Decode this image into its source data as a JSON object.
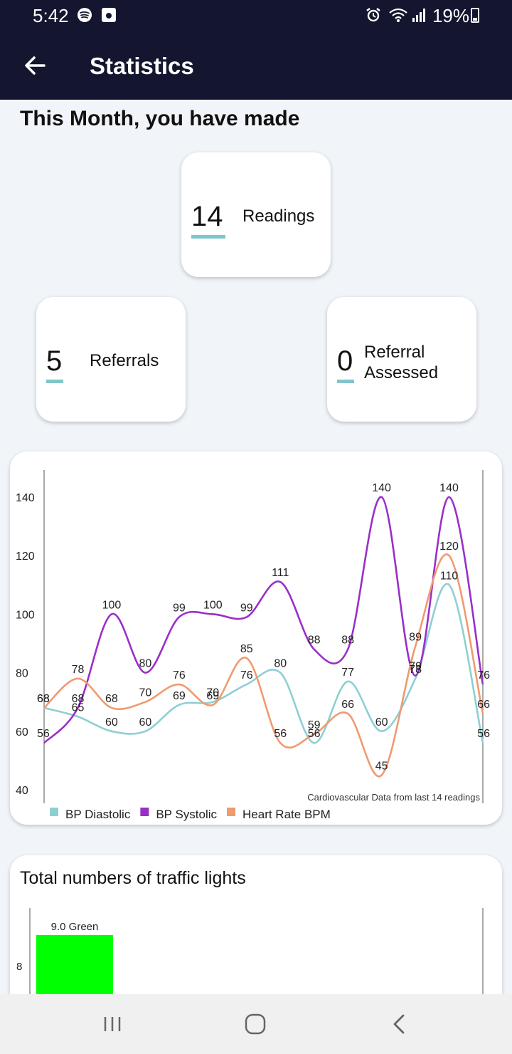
{
  "status_bar": {
    "time": "5:42",
    "battery": "19%"
  },
  "app_bar": {
    "title": "Statistics"
  },
  "summary": {
    "heading": "This Month, you have made",
    "readings": {
      "value": "14",
      "label": "Readings"
    },
    "referrals": {
      "value": "5",
      "label": "Referrals"
    },
    "assessed": {
      "value": "0",
      "label_line1": "Referral",
      "label_line2": "Assessed"
    }
  },
  "colors": {
    "diastolic": "#8ecfd3",
    "systolic": "#9a2fc8",
    "heart_rate": "#f09a70",
    "green": "#00ff00",
    "accent_underline": "#7fc6cc",
    "header_bg": "#141630"
  },
  "chart_data": {
    "type": "line",
    "caption": "Cardiovascular Data from last 14 readings",
    "ylim": [
      40,
      140
    ],
    "yticks": [
      40,
      60,
      80,
      100,
      120,
      140
    ],
    "x": [
      1,
      2,
      3,
      4,
      5,
      6,
      7,
      8,
      9,
      10,
      11,
      12,
      13,
      14
    ],
    "series": [
      {
        "name": "BP Diastolic",
        "color": "#8ecfd3",
        "values": [
          68,
          65,
          60,
          60,
          69,
          70,
          76,
          80,
          56,
          77,
          60,
          78,
          110,
          56
        ]
      },
      {
        "name": "BP Systolic",
        "color": "#9a2fc8",
        "values": [
          56,
          68,
          100,
          80,
          99,
          100,
          99,
          111,
          88,
          88,
          140,
          79,
          140,
          76
        ]
      },
      {
        "name": "Heart Rate BPM",
        "color": "#f09a70",
        "values": [
          68,
          78,
          68,
          70,
          76,
          69,
          85,
          56,
          59,
          66,
          45,
          89,
          120,
          66
        ]
      }
    ],
    "legend_position": "bottom-left"
  },
  "traffic_chart": {
    "title": "Total numbers of traffic lights",
    "type": "bar",
    "categories": [
      "Green"
    ],
    "values": [
      9.0
    ],
    "bar_label": "9.0 Green",
    "visible_ytick": "8"
  }
}
